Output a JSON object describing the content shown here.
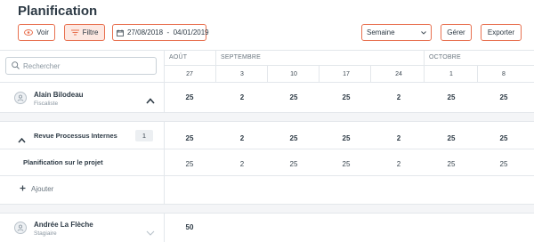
{
  "page": {
    "title": "Planification"
  },
  "toolbar": {
    "voir_label": "Voir",
    "filtre_label": "Filtre",
    "date_range": "27/08/2018  -  04/01/2019",
    "view_select": "Semaine",
    "gerer_label": "Gérer",
    "exporter_label": "Exporter"
  },
  "search": {
    "placeholder": "Rechercher"
  },
  "timeline": {
    "months": [
      "AOÛT",
      "SEPTEMBRE",
      "OCTOBRE"
    ],
    "days": [
      "27",
      "3",
      "10",
      "17",
      "24",
      "1",
      "8"
    ]
  },
  "people": [
    {
      "name": "Alain Bilodeau",
      "role": "Fiscaliste",
      "totals": [
        "25",
        "2",
        "25",
        "25",
        "2",
        "25",
        "25"
      ],
      "groups": [
        {
          "name": "Revue Processus Internes",
          "count": "1",
          "totals": [
            "25",
            "2",
            "25",
            "25",
            "2",
            "25",
            "25"
          ],
          "tasks": [
            {
              "name": "Planification sur le projet",
              "values": [
                "25",
                "2",
                "25",
                "25",
                "2",
                "25",
                "25"
              ]
            }
          ]
        }
      ],
      "add_label": "Ajouter"
    },
    {
      "name": "Andrée La Flèche",
      "role": "Stagiaire",
      "totals": [
        "50"
      ]
    }
  ],
  "colors": {
    "accent": "#e8704f",
    "text": "#2d3a45",
    "band": "#f4f5f7"
  }
}
